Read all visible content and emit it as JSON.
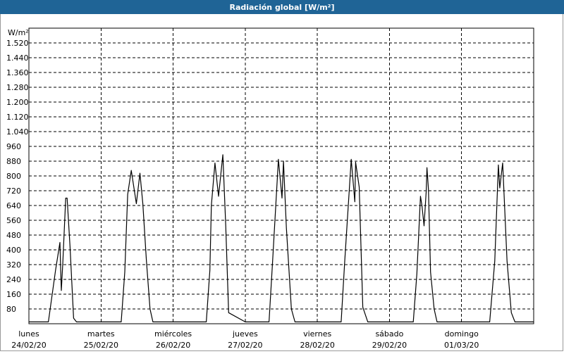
{
  "title": "Radiación global [W/m²]",
  "chart_data": {
    "type": "line",
    "title": "Radiación global [W/m²]",
    "ylabel": "W/m²",
    "xlabel": "",
    "ylim": [
      0,
      1600
    ],
    "yticks": [
      80,
      160,
      240,
      320,
      400,
      480,
      560,
      640,
      720,
      800,
      880,
      960,
      1040,
      1120,
      1200,
      1280,
      1360,
      1440,
      1520
    ],
    "ytick_labels": [
      "80",
      "160",
      "240",
      "320",
      "400",
      "480",
      "560",
      "640",
      "720",
      "800",
      "880",
      "960",
      "1.040",
      "1.120",
      "1.200",
      "1.280",
      "1.360",
      "1.440",
      "1.520"
    ],
    "xlim": [
      0,
      7
    ],
    "days": [
      {
        "weekday": "lunes",
        "date": "24/02/20"
      },
      {
        "weekday": "martes",
        "date": "25/02/20"
      },
      {
        "weekday": "miércoles",
        "date": "26/02/20"
      },
      {
        "weekday": "jueves",
        "date": "27/02/20"
      },
      {
        "weekday": "viernes",
        "date": "28/02/20"
      },
      {
        "weekday": "sábado",
        "date": "29/02/20"
      },
      {
        "weekday": "domingo",
        "date": "01/03/20"
      }
    ],
    "grid": true,
    "series": [
      {
        "color": "#000000",
        "x": [
          0,
          0.27,
          0.33,
          0.37,
          0.43,
          0.44,
          0.45,
          0.47,
          0.51,
          0.53,
          0.57,
          0.62,
          0.66,
          0.68,
          0.71,
          1.0,
          1.28,
          1.33,
          1.37,
          1.42,
          1.49,
          1.54,
          1.58,
          1.63,
          1.68,
          1.72,
          1.79,
          2.0,
          2.28,
          2.34,
          2.38,
          2.46,
          2.51,
          2.53,
          2.58,
          2.63,
          2.69,
          2.73,
          2.77,
          3.0,
          3.28,
          3.33,
          3.38,
          3.46,
          3.51,
          3.53,
          3.57,
          3.64,
          3.69,
          3.73,
          3.79,
          4.0,
          4.28,
          4.33,
          4.38,
          4.47,
          4.52,
          4.53,
          4.58,
          4.63,
          4.7,
          4.73,
          4.78,
          5.0,
          5.27,
          5.33,
          5.38,
          5.43,
          5.45,
          5.48,
          5.51,
          5.52,
          5.54,
          5.57,
          5.62,
          5.66,
          5.68,
          5.71,
          6.0,
          6.28,
          6.33,
          6.39,
          6.46,
          6.51,
          6.53,
          6.57,
          6.63,
          6.69,
          6.74,
          6.78,
          7.0
        ],
        "y": [
          10,
          10,
          180,
          290,
          440,
          300,
          180,
          330,
          680,
          680,
          420,
          30,
          10,
          10,
          10,
          10,
          10,
          280,
          700,
          830,
          650,
          815,
          650,
          340,
          80,
          10,
          10,
          10,
          10,
          10,
          10,
          10,
          290,
          640,
          870,
          690,
          915,
          530,
          60,
          10,
          10,
          10,
          340,
          890,
          680,
          880,
          520,
          80,
          10,
          10,
          10,
          10,
          10,
          10,
          340,
          890,
          660,
          875,
          740,
          90,
          10,
          10,
          10,
          10,
          10,
          10,
          270,
          690,
          640,
          530,
          720,
          845,
          730,
          280,
          80,
          10,
          10,
          10,
          10,
          10,
          10,
          10,
          340,
          860,
          735,
          870,
          340,
          60,
          10,
          10,
          10
        ]
      }
    ]
  }
}
